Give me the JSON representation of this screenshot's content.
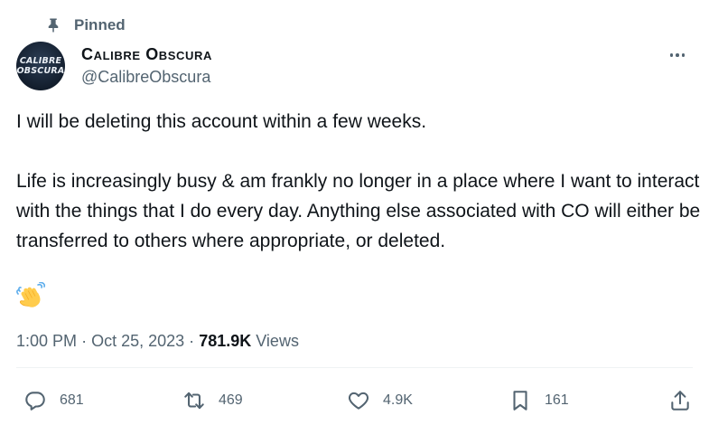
{
  "pinned": {
    "label": "Pinned"
  },
  "author": {
    "display_name": "Calibre Obscura",
    "handle": "@CalibreObscura",
    "avatar_line1": "CALIBRE",
    "avatar_line2": "OBSCURA"
  },
  "tweet": {
    "paragraphs": [
      "I will be deleting this account within a few weeks.",
      "Life is increasingly busy & am frankly no longer in a place where I want to interact with the things that I do every day. Anything else associated with CO will either be transferred to others where appropriate, or deleted."
    ],
    "emoji": "waving-hand-emoji"
  },
  "meta": {
    "time": "1:00 PM",
    "separator": "·",
    "date": "Oct 25, 2023",
    "views_count": "781.9K",
    "views_label": "Views"
  },
  "actions": {
    "replies": "681",
    "reposts": "469",
    "likes": "4.9K",
    "bookmarks": "161"
  },
  "icons": {
    "pin": "pin-icon",
    "more": "more-icon",
    "reply": "reply-icon",
    "repost": "repost-icon",
    "like": "heart-icon",
    "bookmark": "bookmark-icon",
    "share": "share-icon"
  },
  "colors": {
    "text": "#0f1419",
    "secondary": "#536471",
    "divider": "#eff3f4",
    "avatar_bg": "#131e2d"
  }
}
